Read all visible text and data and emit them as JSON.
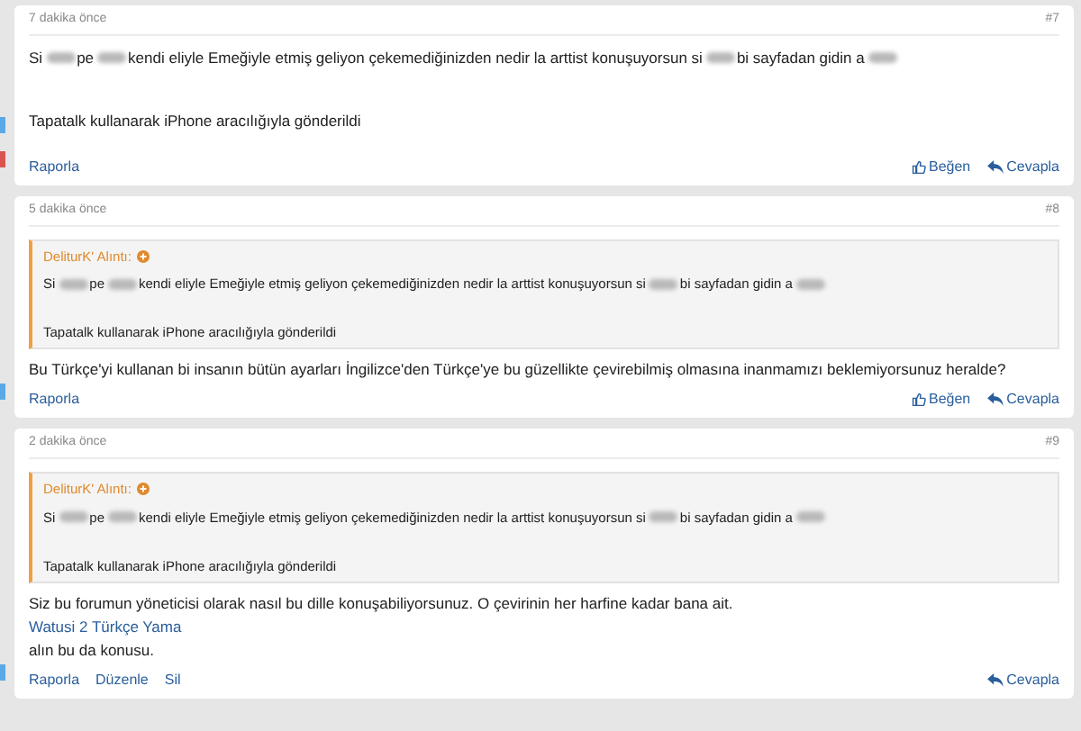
{
  "posts": [
    {
      "time": "7 dakika önce",
      "number": "#7",
      "side_marks": [
        {
          "color": "#5aa9e6"
        },
        {
          "color": "#d9534f"
        }
      ],
      "content": [
        {
          "kind": "message",
          "segments": [
            {
              "kind": "text",
              "text": "Si"
            },
            {
              "kind": "blur"
            },
            {
              "kind": "text",
              "text": "pe"
            },
            {
              "kind": "blur"
            },
            {
              "kind": "text",
              "text": "kendi eliyle Emeğiyle etmiş geliyon çekemediğinizden nedir la arttist konuşuyorsun si"
            },
            {
              "kind": "blur"
            },
            {
              "kind": "text",
              "text": "bi sayfadan gidin a"
            },
            {
              "kind": "blur"
            }
          ]
        },
        {
          "kind": "signature",
          "text": "Tapatalk kullanarak iPhone aracılığıyla gönderildi"
        }
      ],
      "actions_left": [
        "Raporla"
      ],
      "actions_right": [
        {
          "kind": "like",
          "label": "Beğen"
        },
        {
          "kind": "reply",
          "label": "Cevapla"
        }
      ]
    },
    {
      "time": "5 dakika önce",
      "number": "#8",
      "side_marks": [
        {
          "color": "#5aa9e6"
        }
      ],
      "quote": {
        "author": "DeliturK' Alıntı:",
        "content": [
          {
            "kind": "message",
            "segments": [
              {
                "kind": "text",
                "text": "Si"
              },
              {
                "kind": "blur"
              },
              {
                "kind": "text",
                "text": "pe"
              },
              {
                "kind": "blur"
              },
              {
                "kind": "text",
                "text": "kendi eliyle Emeğiyle etmiş geliyon çekemediğinizden nedir la arttist konuşuyorsun si"
              },
              {
                "kind": "blur"
              },
              {
                "kind": "text",
                "text": "bi sayfadan gidin a"
              },
              {
                "kind": "blur"
              }
            ]
          },
          {
            "kind": "signature",
            "text": "Tapatalk kullanarak iPhone aracılığıyla gönderildi"
          }
        ]
      },
      "content": [
        {
          "kind": "text",
          "text": "Bu Türkçe'yi kullanan bi insanın bütün ayarları İngilizce'den Türkçe'ye bu güzellikte çevirebilmiş olmasına inanmamızı beklemiyorsunuz heralde?"
        }
      ],
      "actions_left": [
        "Raporla"
      ],
      "actions_right": [
        {
          "kind": "like",
          "label": "Beğen"
        },
        {
          "kind": "reply",
          "label": "Cevapla"
        }
      ]
    },
    {
      "time": "2 dakika önce",
      "number": "#9",
      "side_marks": [
        {
          "color": "#5aa9e6"
        }
      ],
      "quote": {
        "author": "DeliturK' Alıntı:",
        "content": [
          {
            "kind": "message",
            "segments": [
              {
                "kind": "text",
                "text": "Si"
              },
              {
                "kind": "blur"
              },
              {
                "kind": "text",
                "text": "pe"
              },
              {
                "kind": "blur"
              },
              {
                "kind": "text",
                "text": "kendi eliyle Emeğiyle etmiş geliyon çekemediğinizden nedir la arttist konuşuyorsun si"
              },
              {
                "kind": "blur"
              },
              {
                "kind": "text",
                "text": "bi sayfadan gidin a"
              },
              {
                "kind": "blur"
              }
            ]
          },
          {
            "kind": "signature",
            "text": "Tapatalk kullanarak iPhone aracılığıyla gönderildi"
          }
        ]
      },
      "content": [
        {
          "kind": "text",
          "text": "Siz bu forumun yöneticisi olarak nasıl bu dille konuşabiliyorsunuz. O çevirinin her harfine kadar bana ait."
        },
        {
          "kind": "link",
          "text": "Watusi 2 Türkçe Yama"
        },
        {
          "kind": "text",
          "text": "alın bu da konusu."
        }
      ],
      "actions_left": [
        "Raporla",
        "Düzenle",
        "Sil"
      ],
      "actions_right": [
        {
          "kind": "reply",
          "label": "Cevapla"
        }
      ]
    }
  ]
}
